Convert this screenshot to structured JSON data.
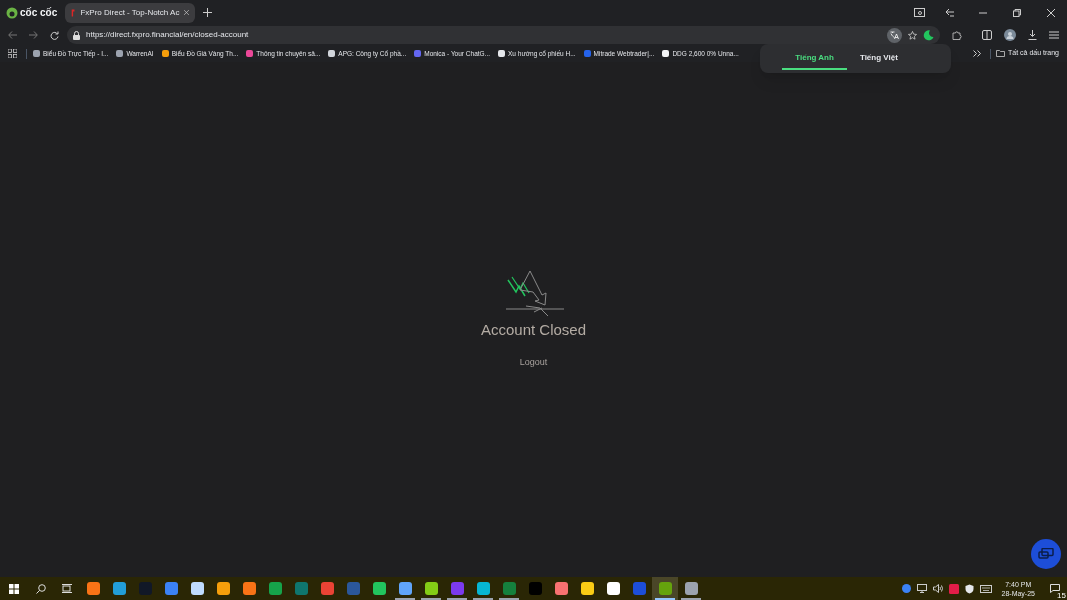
{
  "browser": {
    "brand": "cốc cốc",
    "tab": {
      "title": "FxPro Direct - Top-Notch Ac",
      "selected": true
    },
    "url": "https://direct.fxpro.financial/en/closed-account"
  },
  "bookmarks": [
    {
      "label": "Biểu Đồ Trực Tiếp - I...",
      "color": "#9ca3af"
    },
    {
      "label": "WarrenAI",
      "color": "#9ca3af"
    },
    {
      "label": "Biểu Đồ Giá Vàng Th...",
      "color": "#f59e0b"
    },
    {
      "label": "Thông tin chuyên sâ...",
      "color": "#ec4899"
    },
    {
      "label": "APG: Công ty Cổ phầ...",
      "color": "#d1d5db"
    },
    {
      "label": "Monica - Your ChatG...",
      "color": "#6366f1"
    },
    {
      "label": "Xu hướng cổ phiếu H...",
      "color": "#e5e7eb"
    },
    {
      "label": "Mitrade Webtrader|...",
      "color": "#2563eb"
    },
    {
      "label": "DDG 2,600 0% Unna...",
      "color": "#f3f4f6"
    }
  ],
  "all_bookmarks": "Tất cả dấu trang",
  "translate_popup": {
    "tabs": [
      {
        "label": "Tiếng Anh",
        "selected": true
      },
      {
        "label": "Tiếng Việt",
        "selected": false
      }
    ]
  },
  "page": {
    "heading": "Account Closed",
    "logout": "Logout"
  },
  "taskbar": {
    "apps": [
      {
        "color": "#f97316",
        "open": false,
        "selected": false
      },
      {
        "color": "#229ed9",
        "open": false,
        "selected": false
      },
      {
        "color": "#111827",
        "open": false,
        "selected": false
      },
      {
        "color": "#3b82f6",
        "open": false,
        "selected": false
      },
      {
        "color": "#bfdbfe",
        "open": false,
        "selected": false
      },
      {
        "color": "#f59e0b",
        "open": false,
        "selected": false
      },
      {
        "color": "#f97316",
        "open": false,
        "selected": false
      },
      {
        "color": "#16a34a",
        "open": false,
        "selected": false
      },
      {
        "color": "#0f766e",
        "open": false,
        "selected": false
      },
      {
        "color": "#ea4335",
        "open": false,
        "selected": false
      },
      {
        "color": "#2b579a",
        "open": false,
        "selected": false
      },
      {
        "color": "#22c55e",
        "open": false,
        "selected": false
      },
      {
        "color": "#60a5fa",
        "open": true,
        "selected": false
      },
      {
        "color": "#84cc16",
        "open": true,
        "selected": false
      },
      {
        "color": "#7c3aed",
        "open": true,
        "selected": false
      },
      {
        "color": "#06b6d4",
        "open": true,
        "selected": false
      },
      {
        "color": "#15803d",
        "open": true,
        "selected": false
      },
      {
        "color": "#000000",
        "open": false,
        "selected": false
      },
      {
        "color": "#f87171",
        "open": false,
        "selected": false
      },
      {
        "color": "#facc15",
        "open": false,
        "selected": false
      },
      {
        "color": "#ffffff",
        "open": false,
        "selected": false
      },
      {
        "color": "#1d4ed8",
        "open": false,
        "selected": false
      },
      {
        "color": "#65a30d",
        "open": true,
        "selected": true
      },
      {
        "color": "#9ca3af",
        "open": true,
        "selected": false
      }
    ],
    "time": "7:40 PM",
    "date": "28-May-25",
    "notifications": "15"
  }
}
